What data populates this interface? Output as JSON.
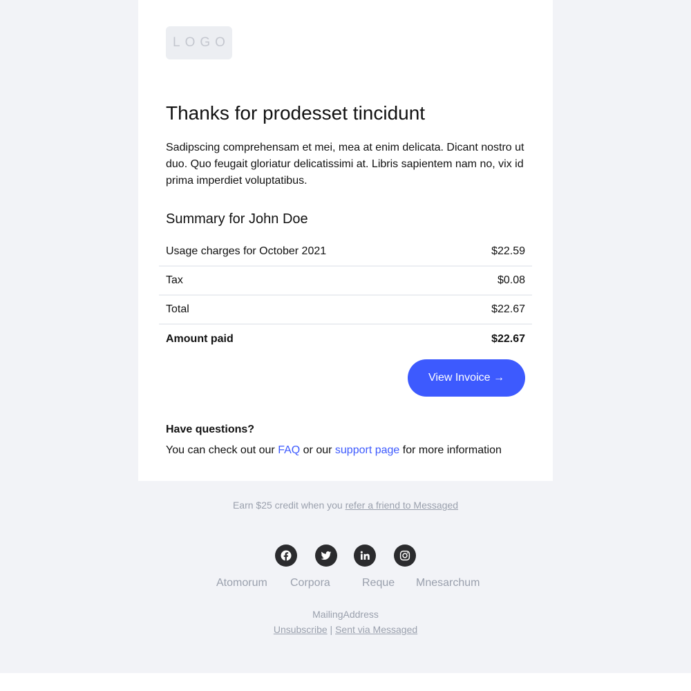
{
  "logo": {
    "text": "LOGO"
  },
  "heading": "Thanks for prodesset tincidunt",
  "intro": "Sadipscing comprehensam et mei, mea at enim delicata. Dicant nostro ut duo. Quo feugait gloriatur delicatissimi at. Libris sapientem nam no, vix id prima imperdiet voluptatibus.",
  "summary": {
    "title": "Summary for John Doe",
    "rows": [
      {
        "label": "Usage charges for October 2021",
        "value": "$22.59"
      },
      {
        "label": "Tax",
        "value": "$0.08"
      },
      {
        "label": "Total",
        "value": "$22.67"
      },
      {
        "label": "Amount paid",
        "value": "$22.67"
      }
    ]
  },
  "button": {
    "label": "View Invoice →"
  },
  "questions": {
    "title": "Have questions?",
    "text_before": "You can check out our ",
    "faq_link": "FAQ",
    "text_middle": " or our ",
    "support_link": "support page",
    "text_after": " for more information"
  },
  "footer": {
    "refer_text": "Earn $25 credit when you ",
    "refer_link": "refer a friend to Messaged",
    "social_icons": [
      "facebook-icon",
      "twitter-icon",
      "linkedin-icon",
      "instagram-icon"
    ],
    "nav_links": [
      "Atomorum",
      "Corpora",
      "Reque",
      "Mnesarchum"
    ],
    "mailing": "MailingAddress",
    "unsubscribe": "Unsubscribe",
    "separator": " | ",
    "sent_via": "Sent via Messaged"
  },
  "colors": {
    "accent": "#3d5afe",
    "background": "#f2f3f7",
    "muted_text": "#9aa0ad",
    "social_bg": "#2b2b2e"
  }
}
